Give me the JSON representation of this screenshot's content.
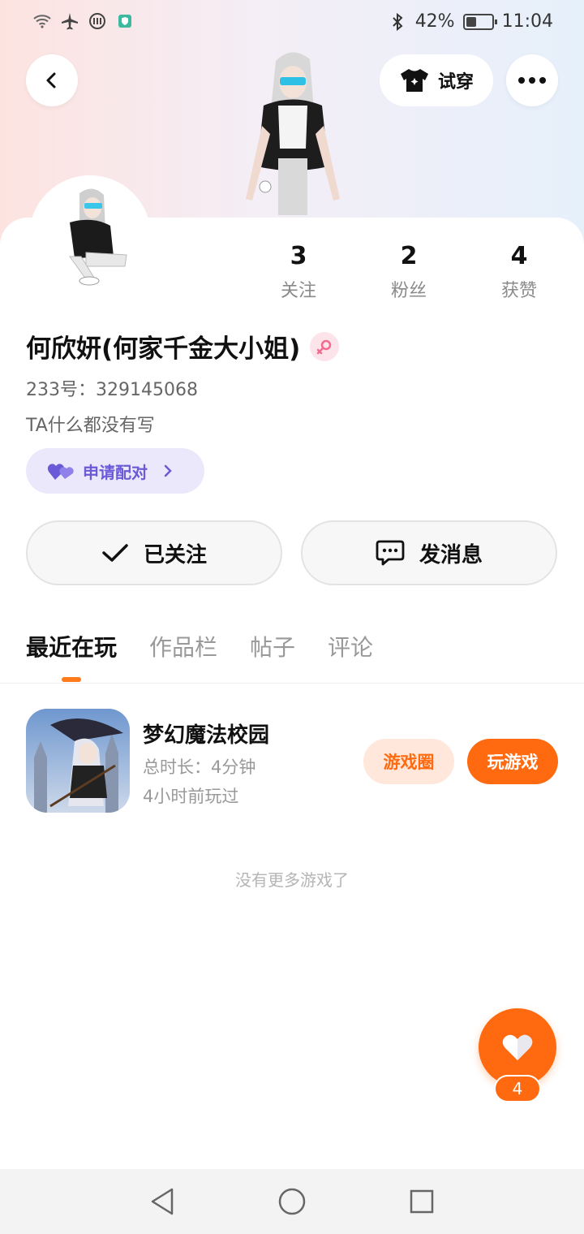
{
  "status_bar": {
    "battery_percent_label": "42%",
    "time": "11:04",
    "battery_level": 0.42,
    "left_icons": [
      "wifi-icon",
      "airplane-icon",
      "data-saver-icon",
      "shield-icon"
    ]
  },
  "header": {
    "try_on_label": "试穿",
    "icons": {
      "back": "chevron-left-icon",
      "try_on": "tshirt-icon",
      "more": "more-dots-icon"
    }
  },
  "profile": {
    "stats": [
      {
        "value": "3",
        "label": "关注"
      },
      {
        "value": "2",
        "label": "粉丝"
      },
      {
        "value": "4",
        "label": "获赞"
      }
    ],
    "username": "何欣妍(何家千金大小姐)",
    "gender_icon": "female-icon",
    "uid_label": "233号：329145068",
    "bio": "TA什么都没有写",
    "pair_label": "申请配对"
  },
  "actions": {
    "follow_label": "已关注",
    "message_label": "发消息"
  },
  "tabs": [
    {
      "label": "最近在玩",
      "active": true
    },
    {
      "label": "作品栏",
      "active": false
    },
    {
      "label": "帖子",
      "active": false
    },
    {
      "label": "评论",
      "active": false
    }
  ],
  "games": [
    {
      "name": "梦幻魔法校园",
      "duration": "总时长：4分钟",
      "last_played": "4小时前玩过",
      "circle_label": "游戏圈",
      "play_label": "玩游戏"
    }
  ],
  "no_more_text": "没有更多游戏了",
  "like": {
    "count": "4"
  },
  "colors": {
    "accent": "#ff6a10",
    "pair_purple": "#6b5ad7",
    "pair_bg": "#ebe8fb"
  }
}
